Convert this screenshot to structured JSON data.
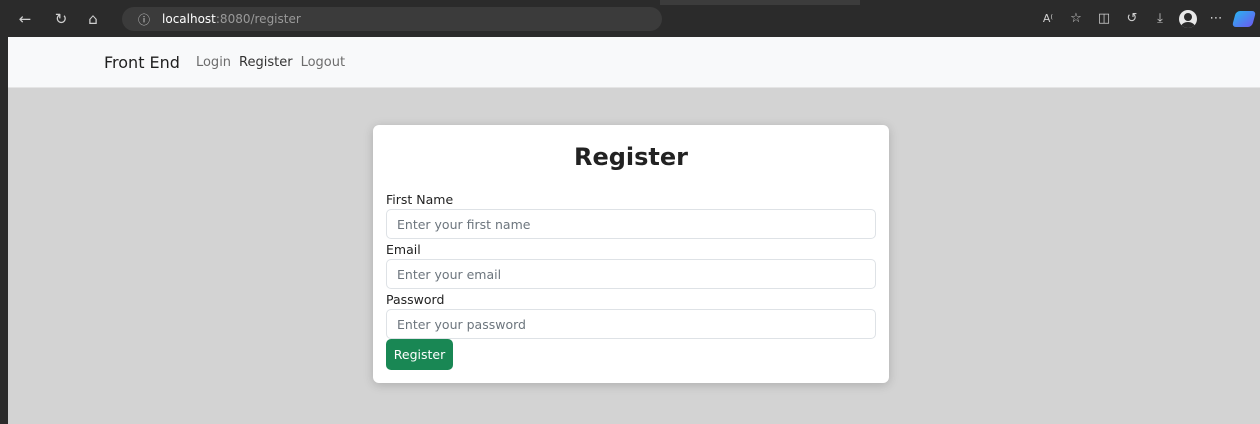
{
  "browser": {
    "address_host": "localhost",
    "address_path": ":8080/register",
    "icons": [
      "back-arrow-icon",
      "refresh-icon",
      "home-icon",
      "info-icon",
      "read-aloud-icon",
      "favorite-star-icon",
      "split-screen-icon",
      "history-icon",
      "download-icon",
      "profile-avatar-icon",
      "more-icon",
      "copilot-icon"
    ]
  },
  "navbar": {
    "brand": "Front End",
    "links": [
      "Login",
      "Register",
      "Logout"
    ]
  },
  "form": {
    "title": "Register",
    "first_name_label": "First Name",
    "first_name_placeholder": "Enter your first name",
    "email_label": "Email",
    "email_placeholder": "Enter your email",
    "password_label": "Password",
    "password_placeholder": "Enter your password",
    "submit_label": "Register"
  },
  "colors": {
    "primary_button": "#198754",
    "page_background": "#d3d3d3"
  }
}
